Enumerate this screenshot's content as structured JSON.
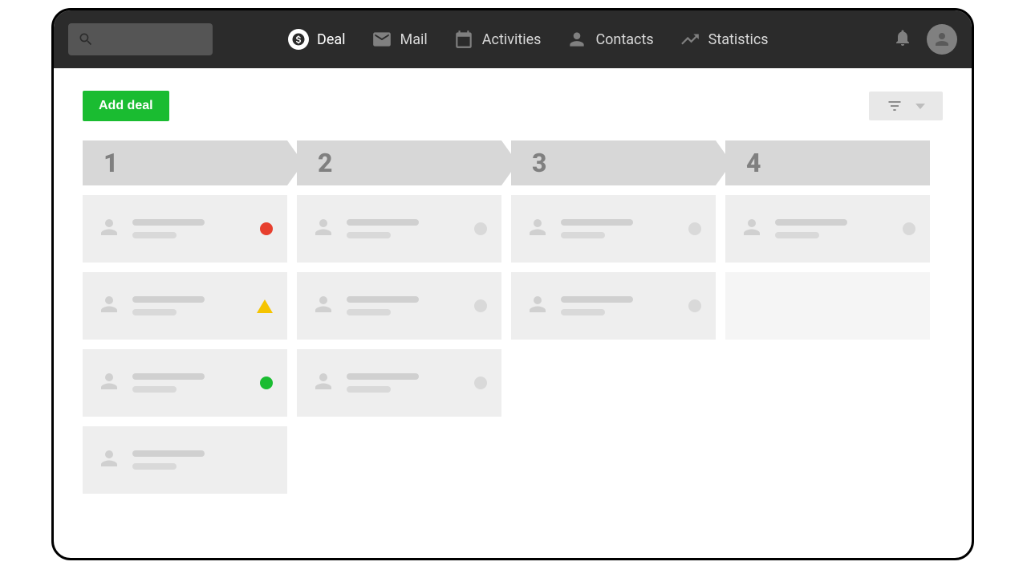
{
  "nav": {
    "deal": "Deal",
    "mail": "Mail",
    "activities": "Activities",
    "contacts": "Contacts",
    "statistics": "Statistics"
  },
  "actions": {
    "add_deal": "Add deal"
  },
  "stages": {
    "s1": "1",
    "s2": "2",
    "s3": "3",
    "s4": "4"
  },
  "pipeline": {
    "stage1": [
      {
        "status": "red"
      },
      {
        "status": "yellow"
      },
      {
        "status": "green"
      },
      {
        "status": "none"
      }
    ],
    "stage2": [
      {
        "status": "gray"
      },
      {
        "status": "gray"
      },
      {
        "status": "gray"
      }
    ],
    "stage3": [
      {
        "status": "gray"
      },
      {
        "status": "gray"
      }
    ],
    "stage4": [
      {
        "status": "gray"
      },
      {
        "status": "empty"
      }
    ]
  }
}
